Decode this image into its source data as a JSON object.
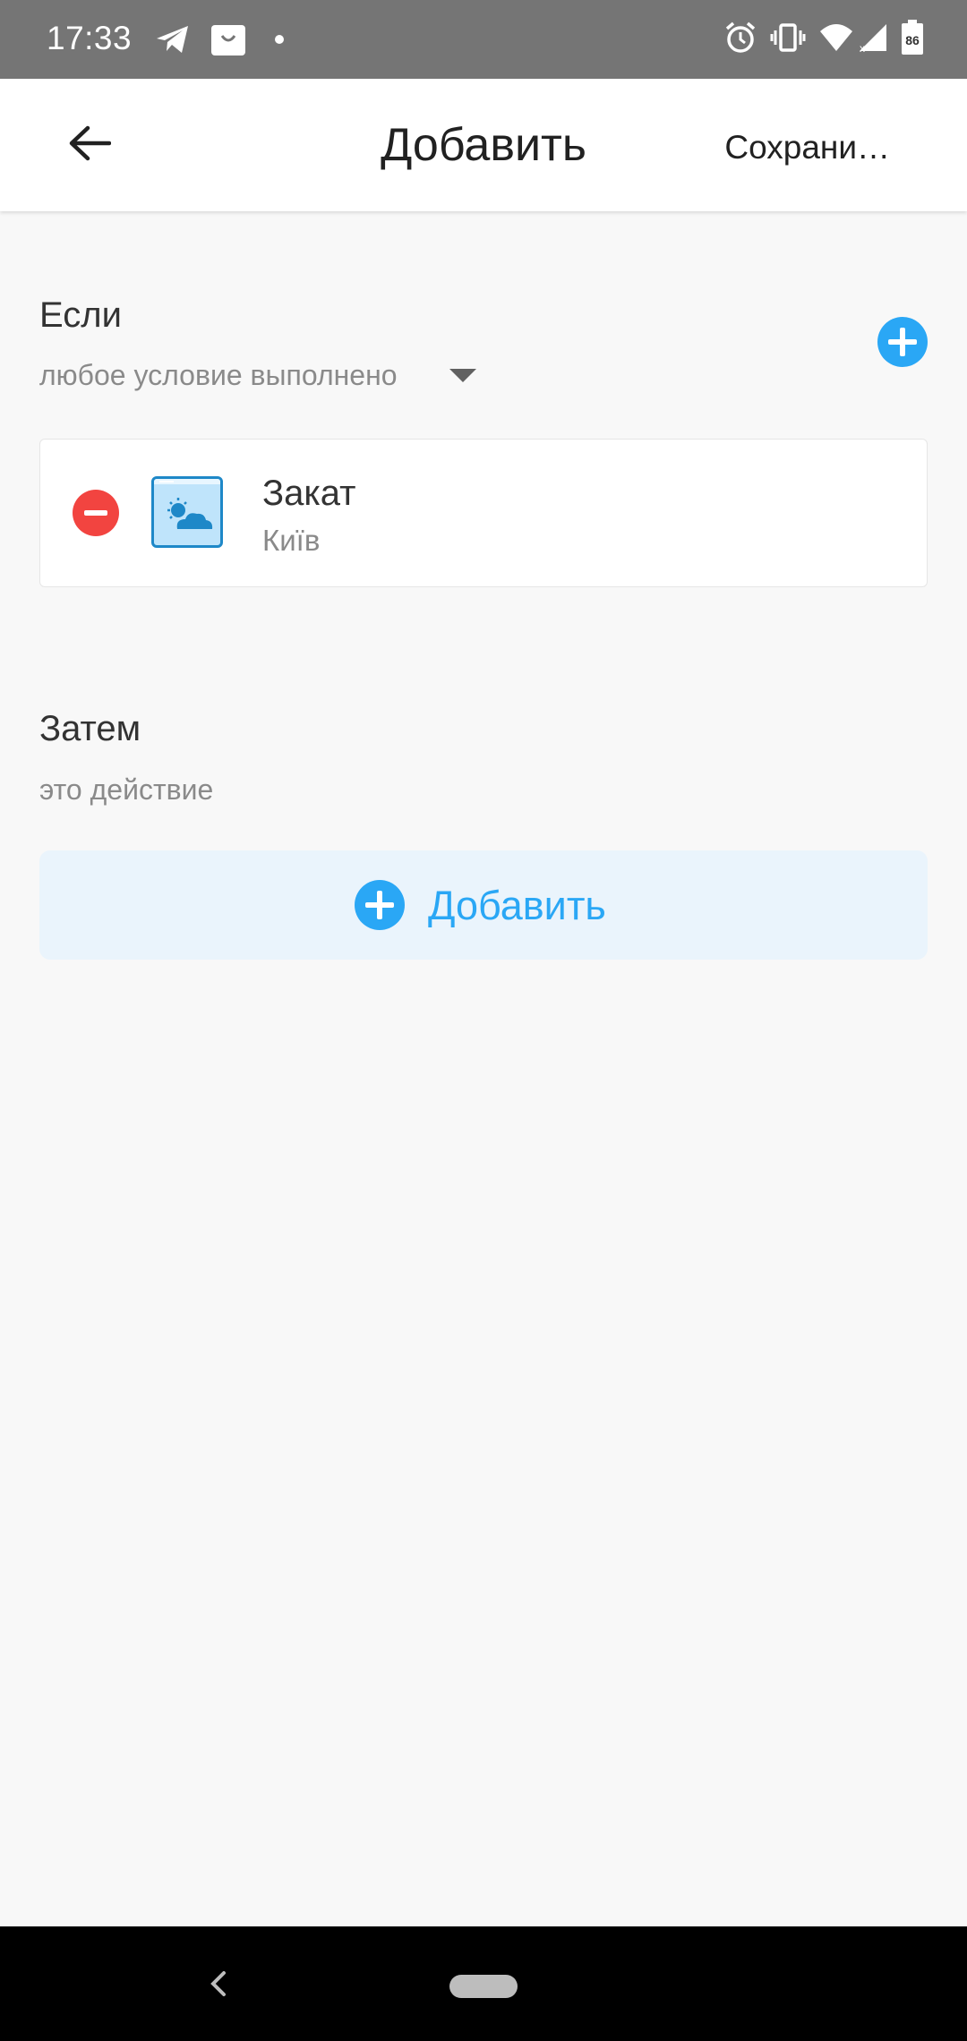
{
  "status_bar": {
    "time": "17:33",
    "battery_level": "86",
    "left_icons": [
      "telegram-icon",
      "shopping-bag-icon",
      "dot-icon"
    ],
    "right_icons": [
      "alarm-icon",
      "vibrate-icon",
      "wifi-icon",
      "signal-icon",
      "battery-icon"
    ]
  },
  "app_bar": {
    "title": "Добавить",
    "save_label": "Сохрани…",
    "back_icon": "arrow-back-icon"
  },
  "if_section": {
    "title": "Если",
    "condition_mode": "любое условие выполнено",
    "add_icon": "plus-circle-icon"
  },
  "conditions": [
    {
      "title": "Закат",
      "subtitle": "Київ",
      "icon": "weather-cloud-sun-icon",
      "remove_icon": "minus-circle-icon"
    }
  ],
  "then_section": {
    "title": "Затем",
    "subtitle": "это действие",
    "add_label": "Добавить",
    "add_icon": "plus-circle-icon"
  },
  "colors": {
    "accent": "#2aa7f5",
    "remove": "#f24440",
    "status_bar": "#757575",
    "background": "#f8f8f8"
  }
}
